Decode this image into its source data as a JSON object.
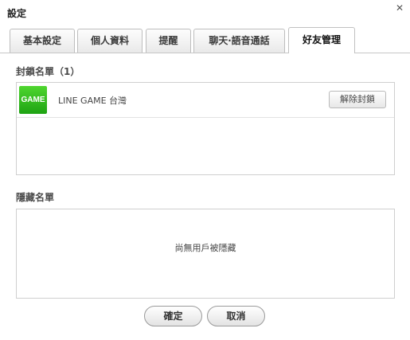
{
  "window": {
    "title": "設定",
    "close_icon": "close-icon"
  },
  "tabs": [
    {
      "label": "基本設定",
      "active": false
    },
    {
      "label": "個人資料",
      "active": false
    },
    {
      "label": "提醒",
      "active": false
    },
    {
      "label": "聊天‧語音通話",
      "active": false
    },
    {
      "label": "好友管理",
      "active": true
    }
  ],
  "blocked": {
    "heading": "封鎖名單（1）",
    "items": [
      {
        "avatar_text": "GAME",
        "name": "LINE GAME 台灣",
        "action_label": "解除封鎖"
      }
    ]
  },
  "hidden": {
    "heading": "隱藏名單",
    "empty_text": "尚無用戶被隱藏"
  },
  "footer": {
    "ok_label": "確定",
    "cancel_label": "取消"
  },
  "colors": {
    "avatar_green": "#2fbd1c",
    "border": "#cfcfcf"
  }
}
